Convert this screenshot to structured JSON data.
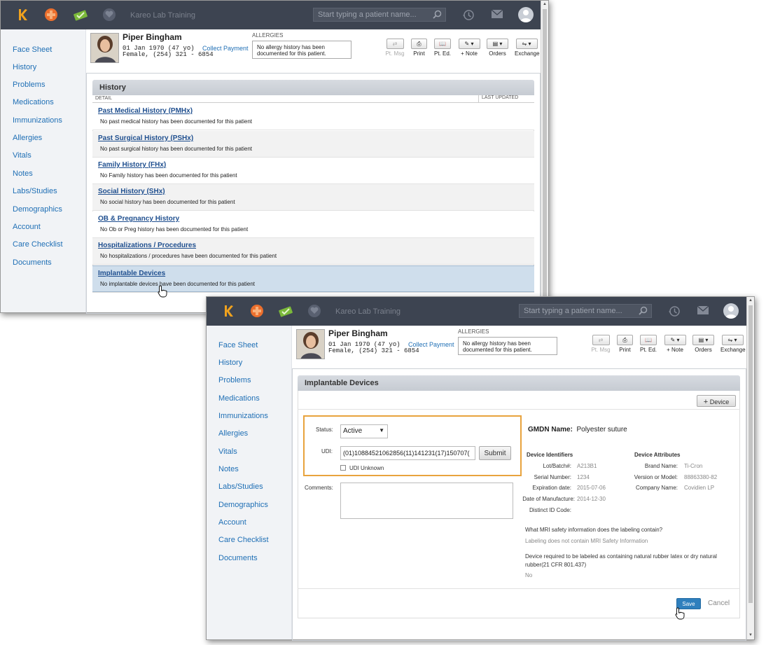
{
  "app": {
    "title": "Kareo Lab Training",
    "search_placeholder": "Start typing a patient name..."
  },
  "sidebar": {
    "items": [
      "Face Sheet",
      "History",
      "Problems",
      "Medications",
      "Immunizations",
      "Allergies",
      "Vitals",
      "Notes",
      "Labs/Studies",
      "Demographics",
      "Account",
      "Care Checklist",
      "Documents"
    ]
  },
  "patient": {
    "name": "Piper Bingham",
    "dob": "01 Jan 1970 (47 yo)",
    "sex_phone": "Female, (254) 321 - 6854",
    "collect_payment": "Collect Payment",
    "allergies_label": "ALLERGIES",
    "allergies_text": "No allergy history has been documented for this patient."
  },
  "toolbar": {
    "pt_msg": "Pt. Msg",
    "print": "Print",
    "pt_ed": "Pt. Ed.",
    "note": "+ Note",
    "orders": "Orders",
    "exchange": "Exchange"
  },
  "history": {
    "title": "History",
    "col_detail": "DETAIL",
    "col_updated": "LAST UPDATED",
    "rows": [
      {
        "title": "Past Medical History (PMHx)",
        "desc": "No past medical history has been documented for this patient"
      },
      {
        "title": "Past Surgical History (PSHx)",
        "desc": "No past surgical history has been documented for this patient"
      },
      {
        "title": "Family History (FHx)",
        "desc": "No Family history has been documented for this patient"
      },
      {
        "title": "Social History (SHx)",
        "desc": "No social history has been documented for this patient"
      },
      {
        "title": "OB & Pregnancy History",
        "desc": "No Ob or Preg history has been documented for this patient"
      },
      {
        "title": "Hospitalizations / Procedures",
        "desc": "No hospitalizations / procedures have been documented for this patient"
      },
      {
        "title": "Implantable Devices",
        "desc": "No implantable devices have been documented for this patient"
      }
    ]
  },
  "device": {
    "title": "Implantable Devices",
    "add_device": "Device",
    "status_label": "Status:",
    "status_value": "Active",
    "udi_label": "UDI:",
    "udi_value": "(01)10884521062856(11)141231(17)150707(",
    "submit": "Submit",
    "udi_unknown": "UDI Unknown",
    "comments_label": "Comments:",
    "gmdn_label": "GMDN Name:",
    "gmdn_value": "Polyester suture",
    "identifiers_title": "Device Identifiers",
    "lot_label": "Lot/Batch#:",
    "lot_value": "A213B1",
    "serial_label": "Serial Number:",
    "serial_value": "1234",
    "exp_label": "Expiration date:",
    "exp_value": "2015-07-06",
    "mfg_label": "Date of Manufacture:",
    "mfg_value": "2014-12-30",
    "distinct_label": "Distinct ID Code:",
    "distinct_value": "",
    "attributes_title": "Device Attributes",
    "brand_label": "Brand Name:",
    "brand_value": "Ti-Cron",
    "version_label": "Version or Model:",
    "version_value": "88863380-82",
    "company_label": "Company Name:",
    "company_value": "Covidien LP",
    "mri_question": "What MRI safety information does the labeling contain?",
    "mri_answer": "Labeling does not contain MRI Safety Information",
    "rubber_question": "Device required to be labeled as containing natural rubber latex or dry natural rubber(21 CFR 801.437)",
    "rubber_answer": "No",
    "save": "Save",
    "cancel": "Cancel"
  },
  "colors": {
    "topbar": "#3d4451",
    "link": "#1f6fb5",
    "highlight": "#e8a33d",
    "save": "#2f7fbd",
    "selected_row": "#cfdeec"
  }
}
